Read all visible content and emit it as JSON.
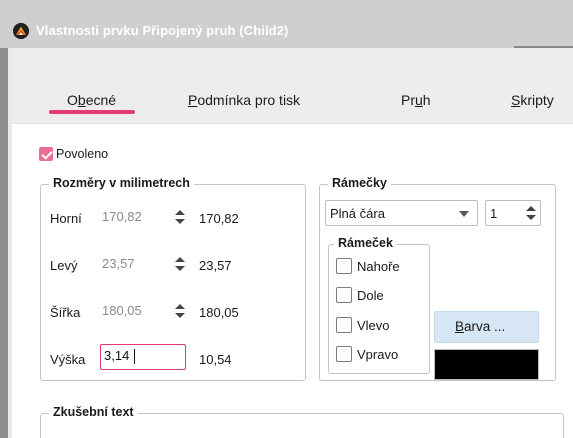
{
  "window": {
    "title": "Vlastnosti prvku Připojený pruh (Child2)"
  },
  "tabs": [
    {
      "label": "Obecné",
      "mnemonic": "b"
    },
    {
      "label": "Podmínka pro tisk",
      "mnemonic": "P"
    },
    {
      "label": "Pruh",
      "mnemonic": "u"
    },
    {
      "label": "Skripty",
      "mnemonic": "S"
    }
  ],
  "active_tab": "Obecné",
  "accent_color": "#e23b6c",
  "enabled": {
    "label": "Povoleno",
    "checked": true
  },
  "dimensions": {
    "legend": "Rozměry v milimetrech",
    "rows": [
      {
        "label": "Horní",
        "value": "170,82",
        "mm": "170,82"
      },
      {
        "label": "Levý",
        "value": "23,57",
        "mm": "23,57"
      },
      {
        "label": "Šířka",
        "value": "180,05",
        "mm": "180,05"
      },
      {
        "label": "Výška",
        "value": "3,14",
        "mm": "10,54"
      }
    ]
  },
  "frames": {
    "legend": "Rámečky",
    "line_style": "Plná čára",
    "line_width": "1",
    "frame": {
      "legend": "Rámeček",
      "items": [
        {
          "label": "Nahoře",
          "checked": false
        },
        {
          "label": "Dole",
          "checked": false
        },
        {
          "label": "Vlevo",
          "checked": false
        },
        {
          "label": "Vpravo",
          "checked": false
        }
      ]
    },
    "color_button": "Barva ...",
    "color_value": "#000000"
  },
  "test_text": {
    "legend": "Zkušební text"
  },
  "icons": {
    "app": "app-logo-icon",
    "spin": "spin-arrows-icon",
    "dropdown": "chevron-down-icon",
    "checkmark": "checkmark-icon"
  }
}
